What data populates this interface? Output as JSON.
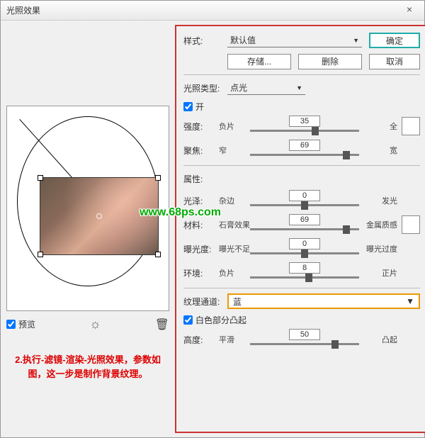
{
  "title": "光照效果",
  "watermark": "www.68ps.com",
  "left": {
    "preview_label": "预览",
    "note": "2.执行-滤镜-渲染-光照效果，参数如图，这一步是制作背景纹理。"
  },
  "right": {
    "style_label": "样式:",
    "style_value": "默认值",
    "ok": "确定",
    "cancel": "取消",
    "save": "存储...",
    "delete": "删除",
    "light_type_label": "光照类型:",
    "light_type_value": "点光",
    "on_label": "开",
    "intensity": {
      "label": "强度:",
      "left": "负片",
      "right": "全",
      "value": "35",
      "pos": 60
    },
    "focus": {
      "label": "聚焦:",
      "left": "窄",
      "right": "宽",
      "value": "69",
      "pos": 88
    },
    "props_label": "属性:",
    "gloss": {
      "label": "光泽:",
      "left": "杂边",
      "right": "发光",
      "value": "0",
      "pos": 50
    },
    "material": {
      "label": "材料:",
      "left": "石膏效果",
      "right": "金属质感",
      "value": "69",
      "pos": 88
    },
    "exposure": {
      "label": "曝光度:",
      "left": "曝光不足",
      "right": "曝光过度",
      "value": "0",
      "pos": 50
    },
    "ambient": {
      "label": "环境:",
      "left": "负片",
      "right": "正片",
      "value": "8",
      "pos": 54
    },
    "tex_channel_label": "纹理通道:",
    "tex_channel_value": "蓝",
    "white_high_label": "白色部分凸起",
    "height": {
      "label": "高度:",
      "left": "平滑",
      "right": "凸起",
      "value": "50",
      "pos": 78
    }
  }
}
